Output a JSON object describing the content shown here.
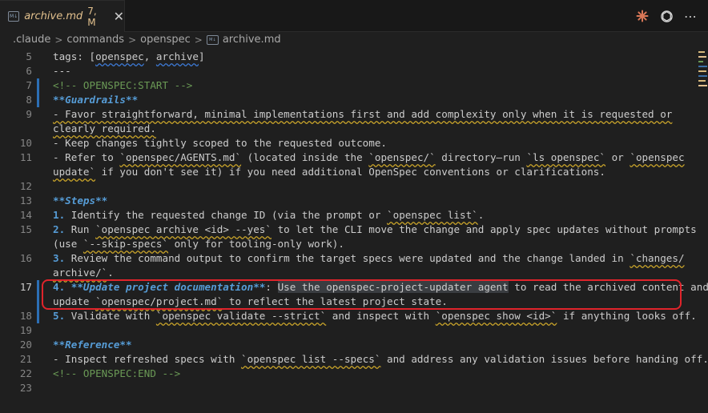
{
  "tab": {
    "filename": "archive.md",
    "status": "7, M",
    "icon": "markdown-file-icon",
    "close_glyph": "✕"
  },
  "breadcrumb": {
    "items": [
      ".claude",
      "commands",
      "openspec"
    ],
    "separator": ">",
    "file": "archive.md"
  },
  "actions": {
    "icons": [
      "claude-icon",
      "openai-icon",
      "more-actions-icon"
    ],
    "more_glyph": "⋯"
  },
  "colors": {
    "background": "#1f1f1f",
    "markup_blue": "#569cd6",
    "comment_green": "#6a9955",
    "modified_yellow": "#e2c08d",
    "annotation_red": "#e0242b"
  },
  "editor": {
    "active_line": 17,
    "lines": [
      {
        "n": "5",
        "p": [
          "tags: [",
          "openspec",
          ", ",
          "archive",
          "]"
        ]
      },
      {
        "n": "6",
        "p": [
          "---"
        ]
      },
      {
        "n": "7",
        "p": [
          "<!-- OPENSPEC:START -->"
        ]
      },
      {
        "n": "8",
        "p": [
          "**Guardrails**"
        ]
      },
      {
        "n": "9",
        "p": [
          "- Favor straightforward, minimal implementations first and add complexity only when it is requested or"
        ]
      },
      {
        "n": "",
        "p": [
          "clearly required."
        ]
      },
      {
        "n": "10",
        "p": [
          "- Keep changes tightly scoped to the requested outcome."
        ]
      },
      {
        "n": "11",
        "p": [
          "- Refer to ",
          "`openspec/AGENTS.md`",
          " (located inside the ",
          "`openspec/`",
          " directory—run ",
          "`ls openspec`",
          " or ",
          "`openspec"
        ]
      },
      {
        "n": "",
        "p": [
          "update`",
          " if you don't see it) if you need additional OpenSpec conventions or clarifications."
        ]
      },
      {
        "n": "12",
        "p": [
          ""
        ]
      },
      {
        "n": "13",
        "p": [
          "**Steps**"
        ]
      },
      {
        "n": "14",
        "p": [
          "1. ",
          "Identify the requested change ID (via the prompt or ",
          "`openspec list`",
          "."
        ]
      },
      {
        "n": "15",
        "p": [
          "2. ",
          "Run ",
          "`openspec archive <id> --yes`",
          " to let the CLI move the change and apply spec updates without prompts"
        ]
      },
      {
        "n": "",
        "p": [
          "(use ",
          "`--skip-specs`",
          " only for tooling-only work)."
        ]
      },
      {
        "n": "16",
        "p": [
          "3. ",
          "Review the command output to confirm the target specs were updated and the change landed in ",
          "`changes/"
        ]
      },
      {
        "n": "",
        "p": [
          "archive/`",
          "."
        ]
      },
      {
        "n": "17",
        "p": [
          "4. ",
          "**Update project documentation**",
          ": ",
          "Use the openspec-project-updater agent",
          " to read the archived content and"
        ]
      },
      {
        "n": "",
        "p": [
          "update ",
          "`openspec/project.md`",
          " to reflect the latest project state."
        ]
      },
      {
        "n": "18",
        "p": [
          "5. ",
          "Validate with ",
          "`openspec validate --strict`",
          " and inspect with ",
          "`openspec show <id>`",
          " if anything looks off."
        ]
      },
      {
        "n": "19",
        "p": [
          ""
        ]
      },
      {
        "n": "20",
        "p": [
          "**Reference**"
        ]
      },
      {
        "n": "21",
        "p": [
          "- Inspect refreshed specs with ",
          "`openspec list --specs`",
          " and address any validation issues before handing off."
        ]
      },
      {
        "n": "22",
        "p": [
          "<!-- OPENSPEC:END -->"
        ]
      },
      {
        "n": "23",
        "p": [
          ""
        ]
      }
    ]
  }
}
